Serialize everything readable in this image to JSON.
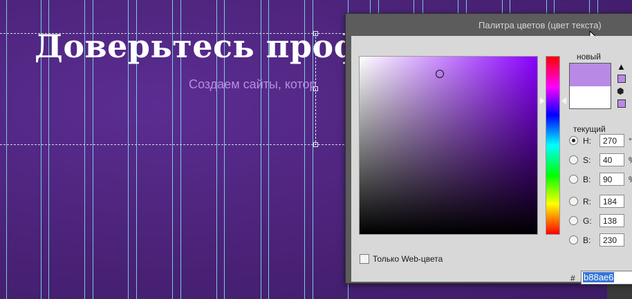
{
  "page": {
    "headline": "Доверьтесь проф",
    "subline": "Создаем сайты, котор"
  },
  "dialog": {
    "title": "Палитра цветов (цвет текста)",
    "label_new": "новый",
    "label_current": "текущий",
    "new_color": "#b88ae6",
    "current_color": "#ffffff",
    "web_only_label": "Только Web-цвета",
    "web_only_checked": false,
    "hash_label": "#",
    "hex_value": "b88ae6",
    "warning_icon": "warning-icon",
    "cube_icon": "cube-icon",
    "fields": [
      {
        "label": "H:",
        "value": "270",
        "unit": "°",
        "selected": true
      },
      {
        "label": "S:",
        "value": "40",
        "unit": "%",
        "selected": false
      },
      {
        "label": "B:",
        "value": "90",
        "unit": "%",
        "selected": false
      },
      {
        "label": "R:",
        "value": "184",
        "unit": "",
        "selected": false
      },
      {
        "label": "G:",
        "value": "138",
        "unit": "",
        "selected": false
      },
      {
        "label": "B:",
        "value": "230",
        "unit": "",
        "selected": false
      }
    ]
  },
  "colors": {
    "background": "#4a2277",
    "guide": "#7fe0ea",
    "subline": "#b58ee0",
    "selection": "#3875d7"
  }
}
